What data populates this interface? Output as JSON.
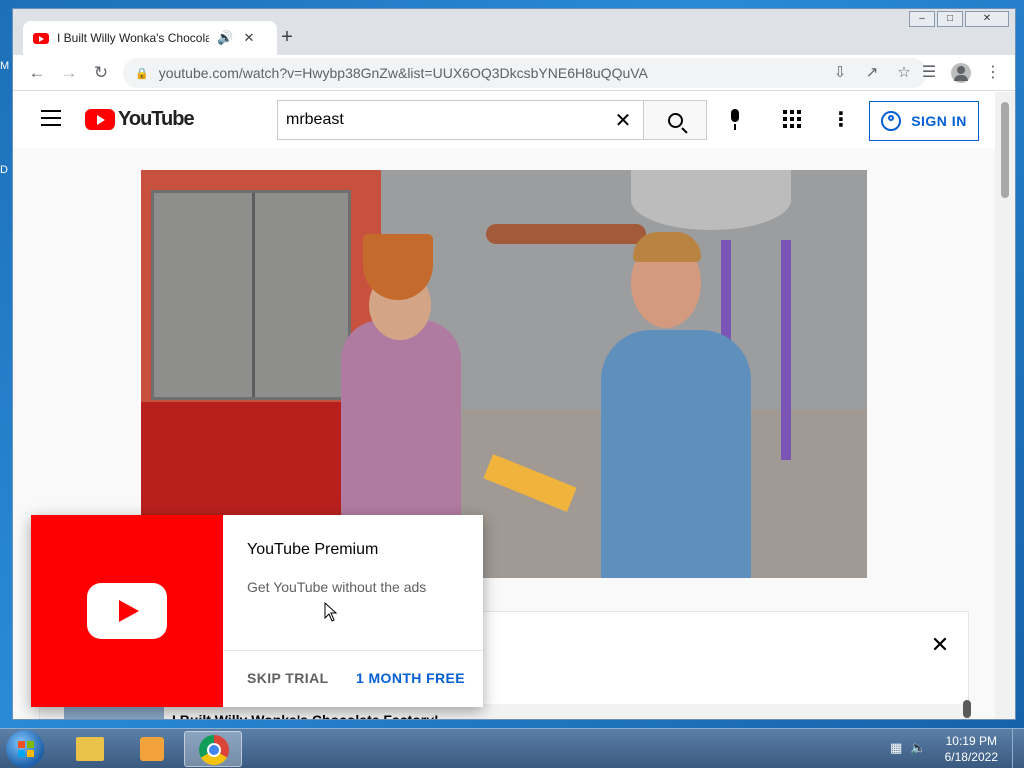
{
  "desktop": {
    "edge_labels": [
      "M",
      "D"
    ]
  },
  "browser": {
    "tab_title": "I Built Willy Wonka's Chocolate Factory!",
    "url": "youtube.com/watch?v=Hwybp38GnZw&list=UUX6OQ3DkcsbYNE6H8uQQuVA",
    "window_controls": {
      "minimize": "–",
      "maximize": "□",
      "close": "✕"
    }
  },
  "youtube": {
    "logo_text": "YouTube",
    "search_value": "mrbeast",
    "sign_in_label": "SIGN IN"
  },
  "promo": {
    "title": "YouTube Premium",
    "subtitle": "Get YouTube without the ads",
    "skip_label": "SKIP TRIAL",
    "cta_label": "1 MONTH FREE"
  },
  "panel": {
    "video_title": "I Built Willy Wonka's Chocolate Factory!"
  },
  "taskbar": {
    "time": "10:19 PM",
    "date": "6/18/2022"
  }
}
